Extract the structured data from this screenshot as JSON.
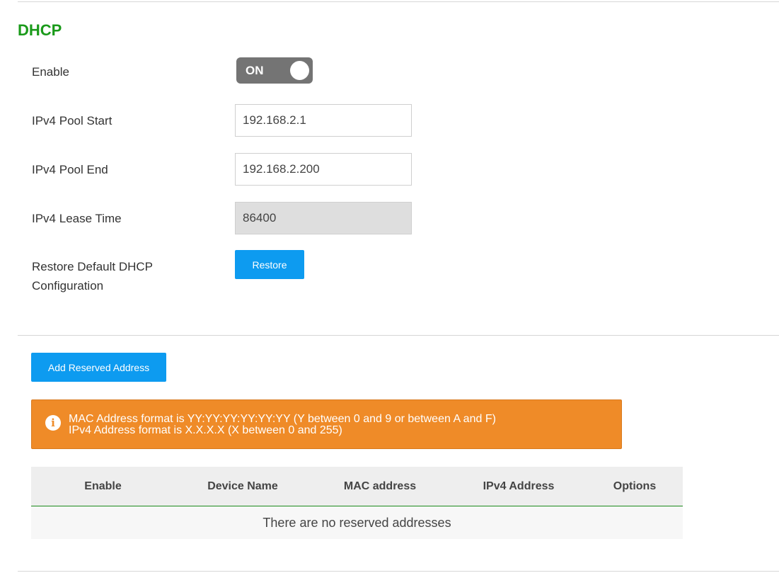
{
  "section": {
    "title": "DHCP"
  },
  "form": {
    "enable": {
      "label": "Enable",
      "toggle_text": "ON"
    },
    "pool_start": {
      "label": "IPv4 Pool Start",
      "value": "192.168.2.1"
    },
    "pool_end": {
      "label": "IPv4 Pool End",
      "value": "192.168.2.200"
    },
    "lease_time": {
      "label": "IPv4 Lease Time",
      "value": "86400"
    },
    "restore": {
      "label_line1": "Restore Default DHCP",
      "label_line2": "Configuration",
      "button": "Restore"
    }
  },
  "reserved": {
    "add_button": "Add Reserved Address",
    "notice": {
      "icon": "info-icon",
      "line1": "MAC Address format is YY:YY:YY:YY:YY:YY (Y between 0 and 9 or between A and F)",
      "line2": "IPv4 Address format is X.X.X.X (X between 0 and 255)"
    },
    "table": {
      "headers": [
        "Enable",
        "Device Name",
        "MAC address",
        "IPv4 Address",
        "Options"
      ],
      "empty_message": "There are no reserved addresses"
    }
  },
  "colors": {
    "title": "#1a9a1a",
    "primary_button": "#0d9bf0",
    "notice_bg": "#ef8b28",
    "toggle_bg": "#747474",
    "table_header_border": "#1a8a1a"
  }
}
